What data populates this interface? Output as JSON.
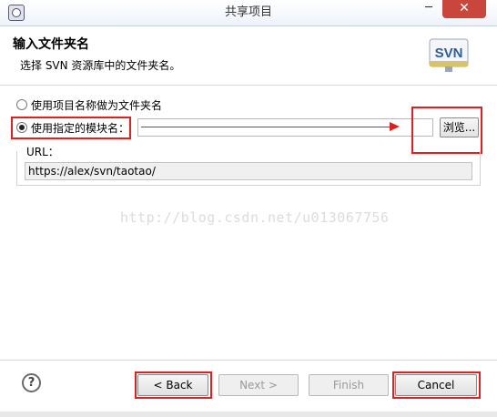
{
  "window": {
    "title": "共享项目",
    "minimize": "─",
    "close": "✕"
  },
  "header": {
    "title": "输入文件夹名",
    "subtitle": "选择 SVN 资源库中的文件夹名。",
    "logo_text": "SVN"
  },
  "options": {
    "use_project_name": {
      "label": "使用项目名称做为文件夹名",
      "selected": false
    },
    "use_module_name": {
      "label": "使用指定的模块名：",
      "selected": true,
      "value": ""
    }
  },
  "browse_label": "浏览...",
  "url": {
    "label": "URL：",
    "value": "https://alex/svn/taotao/"
  },
  "watermark": "http://blog.csdn.net/u013067756",
  "footer": {
    "help": "?",
    "back": "< Back",
    "next": "Next >",
    "finish": "Finish",
    "cancel": "Cancel"
  },
  "colors": {
    "highlight": "#e02020",
    "close_button": "#c9463d",
    "logo_blue": "#2d5d9f"
  }
}
